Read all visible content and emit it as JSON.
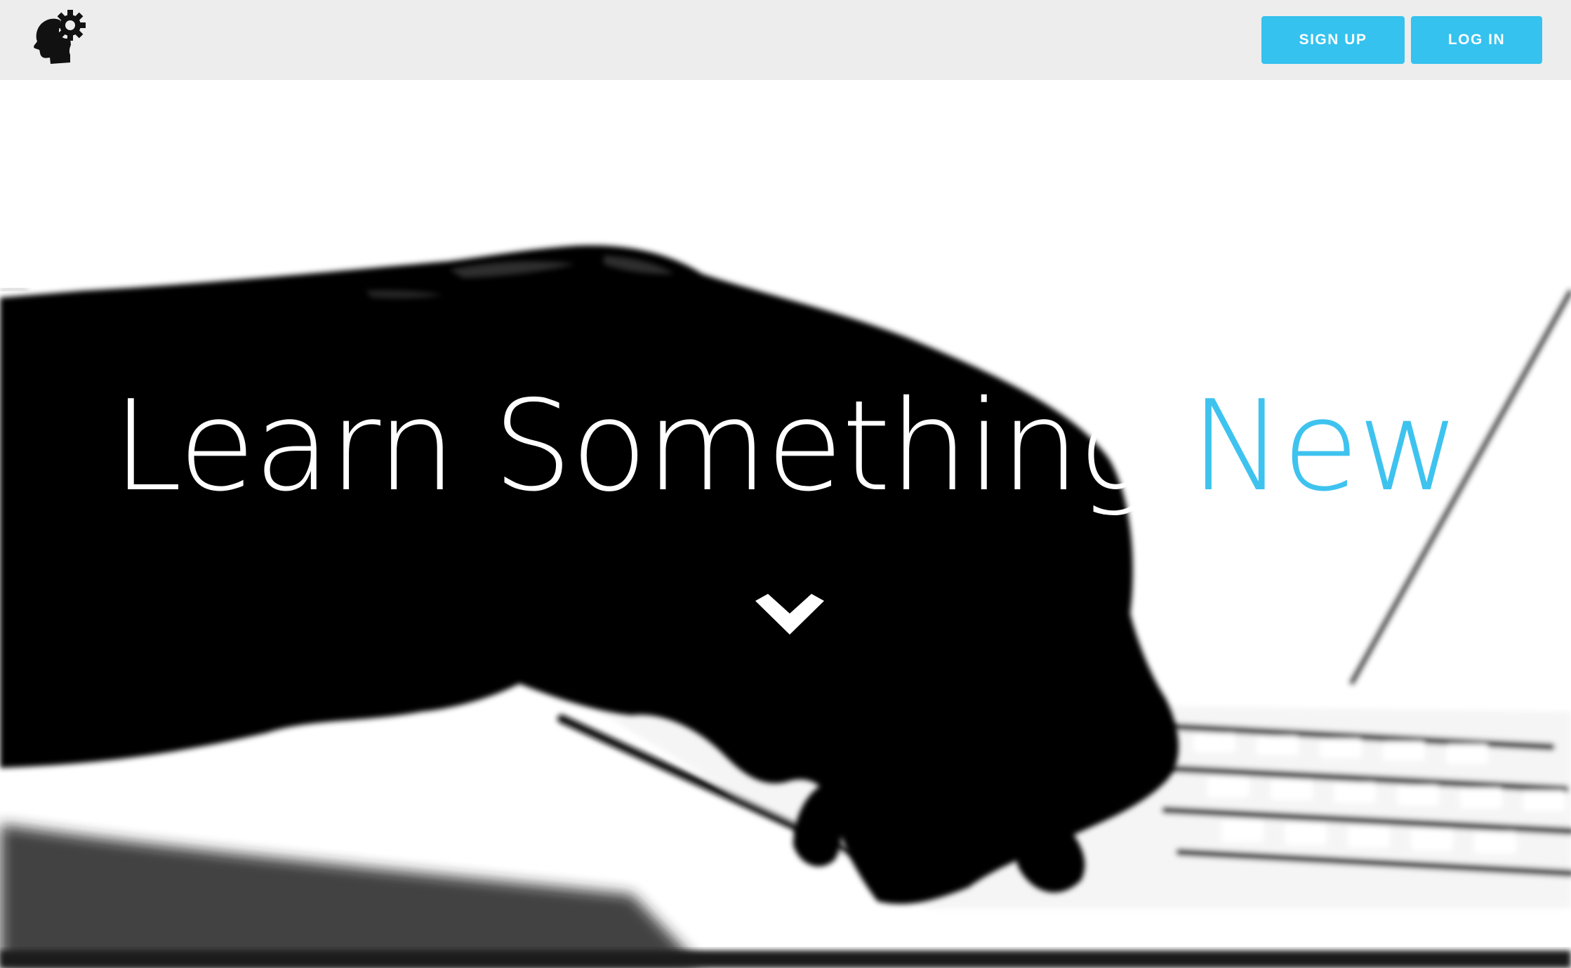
{
  "navbar": {
    "logo_icon": "head-gear-icon",
    "signup_label": "SIGN UP",
    "login_label": "LOG IN",
    "button_color": "#35c2ee",
    "background_color": "#ededed"
  },
  "hero": {
    "headline_part1": "Learn Something",
    "headline_part2": "New",
    "accent_color": "#3ec3ef",
    "scroll_icon": "chevron-down-icon",
    "background_image": "silhouette-hand-typing-on-laptop"
  }
}
